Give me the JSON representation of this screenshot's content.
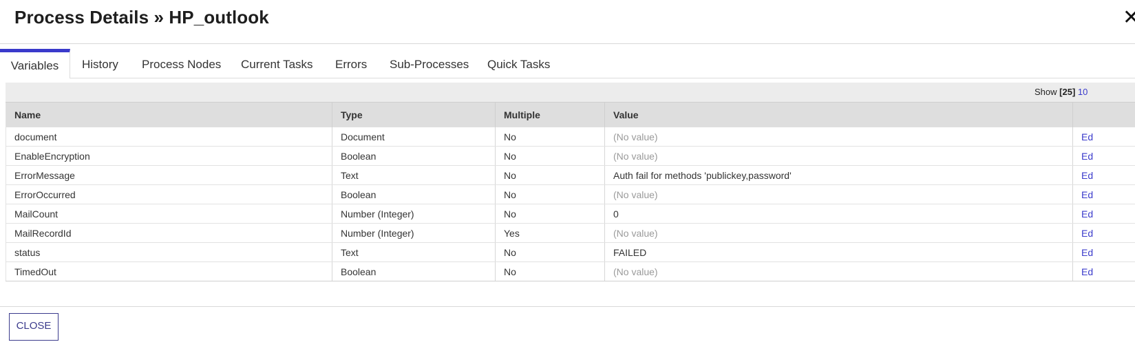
{
  "header": {
    "title": "Process Details » HP_outlook",
    "close_glyph": "✕"
  },
  "tabs": [
    {
      "label": "Variables",
      "active": true
    },
    {
      "label": "History"
    },
    {
      "label": "Process Nodes"
    },
    {
      "label": "Current Tasks"
    },
    {
      "label": "Errors"
    },
    {
      "label": "Sub-Processes"
    },
    {
      "label": "Quick Tasks"
    }
  ],
  "toolbar": {
    "show_label": "Show",
    "show_current": "[25]",
    "show_next": "10"
  },
  "table": {
    "columns": [
      "Name",
      "Type",
      "Multiple",
      "Value"
    ],
    "rows": [
      {
        "name": "document",
        "type": "Document",
        "multiple": "No",
        "value": "(No value)",
        "action": "Ed"
      },
      {
        "name": "EnableEncryption",
        "type": "Boolean",
        "multiple": "No",
        "value": "(No value)",
        "action": "Ed"
      },
      {
        "name": "ErrorMessage",
        "type": "Text",
        "multiple": "No",
        "value": "Auth fail for methods 'publickey,password'",
        "action": "Ed"
      },
      {
        "name": "ErrorOccurred",
        "type": "Boolean",
        "multiple": "No",
        "value": "(No value)",
        "action": "Ed"
      },
      {
        "name": "MailCount",
        "type": "Number (Integer)",
        "multiple": "No",
        "value": "0",
        "action": "Ed"
      },
      {
        "name": "MailRecordId",
        "type": "Number (Integer)",
        "multiple": "Yes",
        "value": "(No value)",
        "action": "Ed"
      },
      {
        "name": "status",
        "type": "Text",
        "multiple": "No",
        "value": "FAILED",
        "action": "Ed"
      },
      {
        "name": "TimedOut",
        "type": "Boolean",
        "multiple": "No",
        "value": "(No value)",
        "action": "Ed"
      }
    ]
  },
  "footer": {
    "close_label": "CLOSE"
  },
  "colors": {
    "accent": "#3a3acb",
    "header_bg": "#dedede",
    "no_value_text": "#9a9a9a"
  }
}
